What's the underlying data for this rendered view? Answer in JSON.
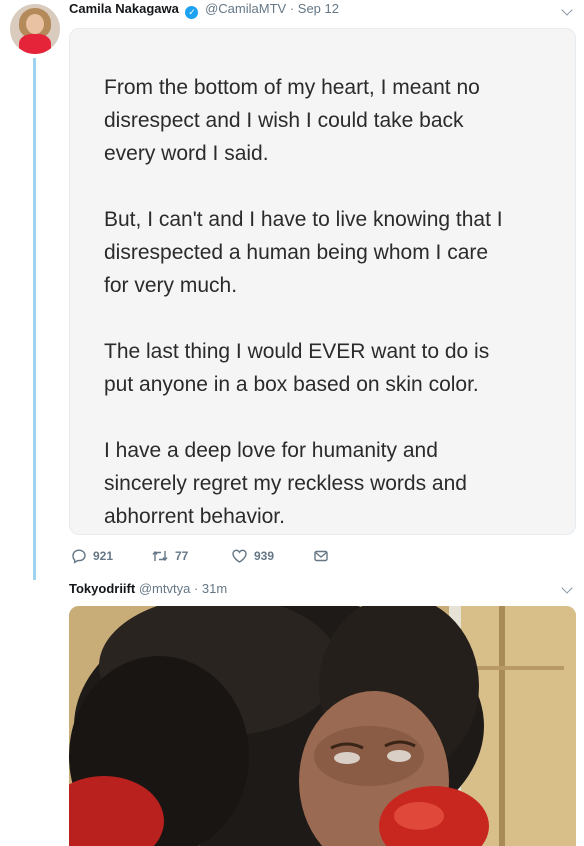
{
  "tweet1": {
    "author_name": "Camila Nakagawa",
    "handle": "@CamilaMTV",
    "time": "Sep 12",
    "separator": "·",
    "notes_paragraphs": [
      "From the bottom of my heart, I meant no\ndisrespect and I wish I could take back\nevery word I said.",
      "But, I can't and I have to live knowing that I\ndisrespected a human being whom I care\nfor very much.",
      "The last thing I would EVER want to do is\nput anyone in a box based on skin color.",
      "I have a deep love for humanity and\nsincerely regret my reckless words and\nabhorrent behavior."
    ],
    "replies": "921",
    "retweets": "77",
    "likes": "939",
    "icons": [
      "reply-icon",
      "retweet-icon",
      "like-icon",
      "message-icon",
      "verified-icon",
      "chevron-down-icon"
    ]
  },
  "tweet2": {
    "author_name": "Tokyodriift",
    "handle": "@mtvtya",
    "time": "31m",
    "separator": "·"
  },
  "colors": {
    "thread_line": "#9fd4f0",
    "verified": "#1da1f2",
    "secondary_text": "#657786"
  }
}
